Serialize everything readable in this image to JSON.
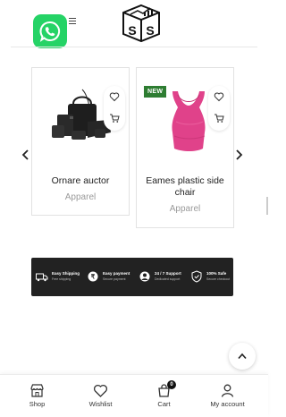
{
  "header": {
    "whatsapp_icon": "whatsapp-icon",
    "menu_icon": "hamburger-menu-icon",
    "logo_letters": [
      "S",
      "S"
    ]
  },
  "products": [
    {
      "name": "Ornare auctor",
      "category": "Apparel",
      "badge": ""
    },
    {
      "name": "Eames plastic side chair",
      "category": "Apparel",
      "badge": "NEW"
    }
  ],
  "features": [
    {
      "title": "Easy Shipping",
      "subtitle": "Free shipping"
    },
    {
      "title": "Easy payment",
      "subtitle": "Secure payment"
    },
    {
      "title": "24 / 7 Support",
      "subtitle": "Dedicated support"
    },
    {
      "title": "100% Safe",
      "subtitle": "Secure checkout"
    }
  ],
  "bottom_nav": [
    {
      "label": "Shop",
      "icon": "shop-icon"
    },
    {
      "label": "Wishlist",
      "icon": "heart-icon"
    },
    {
      "label": "Cart",
      "icon": "cart-icon",
      "badge": "0"
    },
    {
      "label": "My account",
      "icon": "user-icon"
    }
  ],
  "colors": {
    "whatsapp": "#25d366",
    "new_badge": "#2e7d32",
    "features_bg": "#222222"
  }
}
